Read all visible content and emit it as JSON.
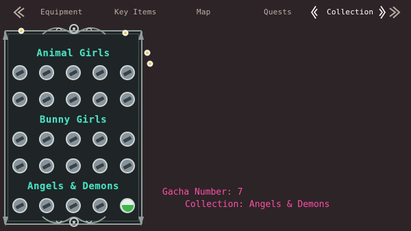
{
  "nav": {
    "tabs": [
      "Equipment",
      "Key Items",
      "Map",
      "Quests",
      "Collection"
    ],
    "active_tab": "Collection"
  },
  "collection": {
    "sections": [
      {
        "title": "Animal Girls",
        "slots": 10,
        "filled": []
      },
      {
        "title": "Bunny Girls",
        "slots": 10,
        "filled": []
      },
      {
        "title": "Angels & Demons",
        "slots": 5,
        "filled": [
          4
        ]
      }
    ]
  },
  "details": {
    "gacha_label": "Gacha Number:",
    "gacha_number": "7",
    "collection_label": "Collection:",
    "collection_value": "Angels & Demons"
  },
  "colors": {
    "background": "#2d2427",
    "section_title": "#52e0c4",
    "info_text": "#ff4fa8",
    "panel_border": "#8f9c9a"
  }
}
